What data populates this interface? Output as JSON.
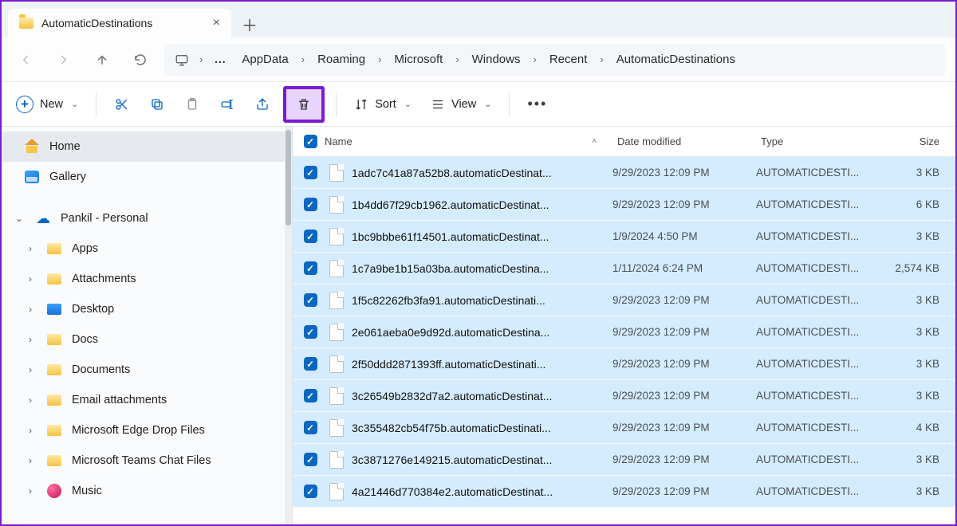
{
  "tab": {
    "title": "AutomaticDestinations"
  },
  "breadcrumbs": {
    "b0": "AppData",
    "b1": "Roaming",
    "b2": "Microsoft",
    "b3": "Windows",
    "b4": "Recent",
    "b5": "AutomaticDestinations"
  },
  "toolbar": {
    "new_label": "New",
    "sort_label": "Sort",
    "view_label": "View"
  },
  "columns": {
    "name": "Name",
    "date": "Date modified",
    "type": "Type",
    "size": "Size"
  },
  "sidebar": {
    "home": "Home",
    "gallery": "Gallery",
    "acct": "Pankil - Personal",
    "i0": "Apps",
    "i1": "Attachments",
    "i2": "Desktop",
    "i3": "Docs",
    "i4": "Documents",
    "i5": "Email attachments",
    "i6": "Microsoft Edge Drop Files",
    "i7": "Microsoft Teams Chat Files",
    "i8": "Music"
  },
  "type_label": "AUTOMATICDESTI...",
  "files": {
    "f0": {
      "name": "1adc7c41a87a52b8.automaticDestinat...",
      "date": "9/29/2023 12:09 PM",
      "size": "3 KB"
    },
    "f1": {
      "name": "1b4dd67f29cb1962.automaticDestinat...",
      "date": "9/29/2023 12:09 PM",
      "size": "6 KB"
    },
    "f2": {
      "name": "1bc9bbbe61f14501.automaticDestinat...",
      "date": "1/9/2024 4:50 PM",
      "size": "3 KB"
    },
    "f3": {
      "name": "1c7a9be1b15a03ba.automaticDestina...",
      "date": "1/11/2024 6:24 PM",
      "size": "2,574 KB"
    },
    "f4": {
      "name": "1f5c82262fb3fa91.automaticDestinati...",
      "date": "9/29/2023 12:09 PM",
      "size": "3 KB"
    },
    "f5": {
      "name": "2e061aeba0e9d92d.automaticDestina...",
      "date": "9/29/2023 12:09 PM",
      "size": "3 KB"
    },
    "f6": {
      "name": "2f50ddd2871393ff.automaticDestinati...",
      "date": "9/29/2023 12:09 PM",
      "size": "3 KB"
    },
    "f7": {
      "name": "3c26549b2832d7a2.automaticDestinat...",
      "date": "9/29/2023 12:09 PM",
      "size": "3 KB"
    },
    "f8": {
      "name": "3c355482cb54f75b.automaticDestinati...",
      "date": "9/29/2023 12:09 PM",
      "size": "4 KB"
    },
    "f9": {
      "name": "3c3871276e149215.automaticDestinat...",
      "date": "9/29/2023 12:09 PM",
      "size": "3 KB"
    },
    "f10": {
      "name": "4a21446d770384e2.automaticDestinat...",
      "date": "9/29/2023 12:09 PM",
      "size": "3 KB"
    }
  }
}
